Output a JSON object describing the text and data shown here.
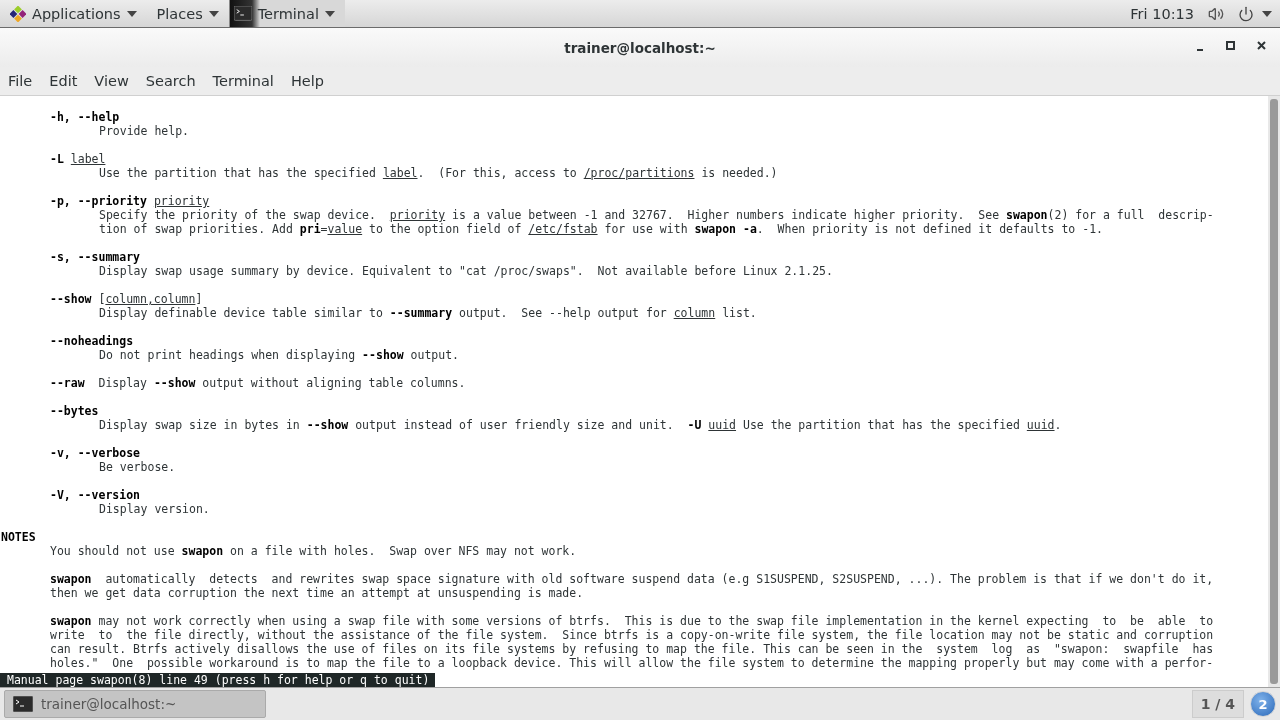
{
  "top_bar": {
    "menus": [
      {
        "label": "Applications",
        "kind": "apps"
      },
      {
        "label": "Places",
        "kind": "plain"
      },
      {
        "label": "Terminal",
        "kind": "app"
      }
    ],
    "clock": "Fri 10:13"
  },
  "window": {
    "title": "trainer@localhost:~",
    "menu": [
      "File",
      "Edit",
      "View",
      "Search",
      "Terminal",
      "Help"
    ]
  },
  "terminal": {
    "blocks": [
      {
        "lines": [
          {
            "kind": "term",
            "text": "**-h, --help**"
          },
          {
            "kind": "desc",
            "text": "Provide help."
          }
        ]
      },
      {
        "lines": [
          {
            "kind": "term",
            "text": "**-L** *label*"
          },
          {
            "kind": "desc",
            "text": "Use the partition that has the specified *label*.  (For this, access to */proc/partitions* is needed.)"
          }
        ]
      },
      {
        "lines": [
          {
            "kind": "term",
            "text": "**-p, --priority** *priority*"
          },
          {
            "kind": "desc",
            "text": "Specify the priority of the swap device.  *priority* is a value between -1 and 32767.  Higher numbers indicate higher priority.  See **swapon**(2) for a full  descrip-"
          },
          {
            "kind": "desc",
            "text": "tion of swap priorities. Add **pri**=*value* to the option field of */etc/fstab* for use with **swapon -a**.  When priority is not defined it defaults to -1."
          }
        ]
      },
      {
        "lines": [
          {
            "kind": "term",
            "text": "**-s, --summary**"
          },
          {
            "kind": "desc",
            "text": "Display swap usage summary by device. Equivalent to \"cat /proc/swaps\".  Not available before Linux 2.1.25."
          }
        ]
      },
      {
        "lines": [
          {
            "kind": "term",
            "text": "**--show** [*column,column*]"
          },
          {
            "kind": "desc",
            "text": "Display definable device table similar to **--summary** output.  See --help output for *column* list."
          }
        ]
      },
      {
        "lines": [
          {
            "kind": "term",
            "text": "**--noheadings**"
          },
          {
            "kind": "desc",
            "text": "Do not print headings when displaying **--show** output."
          }
        ]
      },
      {
        "lines": [
          {
            "kind": "term",
            "text": "**--raw**  Display **--show** output without aligning table columns."
          }
        ]
      },
      {
        "lines": [
          {
            "kind": "term",
            "text": "**--bytes**"
          },
          {
            "kind": "desc",
            "text": "Display swap size in bytes in **--show** output instead of user friendly size and unit.  **-U** *uuid* Use the partition that has the specified *uuid*."
          }
        ]
      },
      {
        "lines": [
          {
            "kind": "term",
            "text": "**-v, --verbose**"
          },
          {
            "kind": "desc",
            "text": "Be verbose."
          }
        ]
      },
      {
        "lines": [
          {
            "kind": "term",
            "text": "**-V, --version**"
          },
          {
            "kind": "desc",
            "text": "Display version."
          }
        ]
      },
      {
        "lines": [
          {
            "kind": "heading",
            "text": "NOTES"
          },
          {
            "kind": "para",
            "text": "You should not use **swapon** on a file with holes.  Swap over NFS may not work."
          }
        ]
      },
      {
        "lines": [
          {
            "kind": "para",
            "text": "**swapon**  automatically  detects  and rewrites swap space signature with old software suspend data (e.g S1SUSPEND, S2SUSPEND, ...). The problem is that if we don't do it,"
          },
          {
            "kind": "para",
            "text": "then we get data corruption the next time an attempt at unsuspending is made."
          }
        ]
      },
      {
        "lines": [
          {
            "kind": "para",
            "text": "**swapon** may not work correctly when using a swap file with some versions of btrfs.  This is due to the swap file implementation in the kernel expecting  to  be  able  to"
          },
          {
            "kind": "para",
            "text": "write  to  the file directly, without the assistance of the file system.  Since btrfs is a copy-on-write file system, the file location may not be static and corruption"
          },
          {
            "kind": "para",
            "text": "can result. Btrfs actively disallows the use of files on its file systems by refusing to map the file. This can be seen in the  system  log  as  \"swapon:  swapfile  has"
          },
          {
            "kind": "para",
            "text": "holes.\"  One  possible workaround is to map the file to a loopback device. This will allow the file system to determine the mapping properly but may come with a perfor-"
          }
        ]
      }
    ],
    "status": "Manual page swapon(8) line 49 (press h for help or q to quit)"
  },
  "taskbar": {
    "tasks": [
      {
        "label": "trainer@localhost:~",
        "selected": true
      }
    ],
    "workspace": "1 / 4",
    "notifications": "2"
  }
}
